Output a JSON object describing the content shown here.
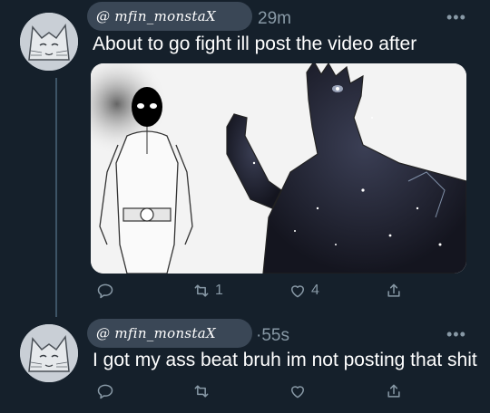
{
  "tweets": [
    {
      "handle": "@ mfin_monstaX",
      "time": "29m",
      "more": "•••",
      "text": "About to go fight ill post the video after",
      "media": "image",
      "actions": {
        "reply_count": "",
        "retweet_count": "1",
        "like_count": "4"
      }
    },
    {
      "handle": "@ mfin_monstaX",
      "time": "·55s",
      "more": "•••",
      "text": "I got my ass beat bruh im not posting that shit",
      "actions": {
        "reply_count": "",
        "retweet_count": "",
        "like_count": ""
      }
    }
  ],
  "icons": {
    "reply": "reply-icon",
    "retweet": "retweet-icon",
    "like": "heart-icon",
    "share": "share-icon"
  },
  "colors": {
    "background": "#15202b",
    "secondary_text": "#8899a6",
    "thread_line": "#3d5466"
  }
}
